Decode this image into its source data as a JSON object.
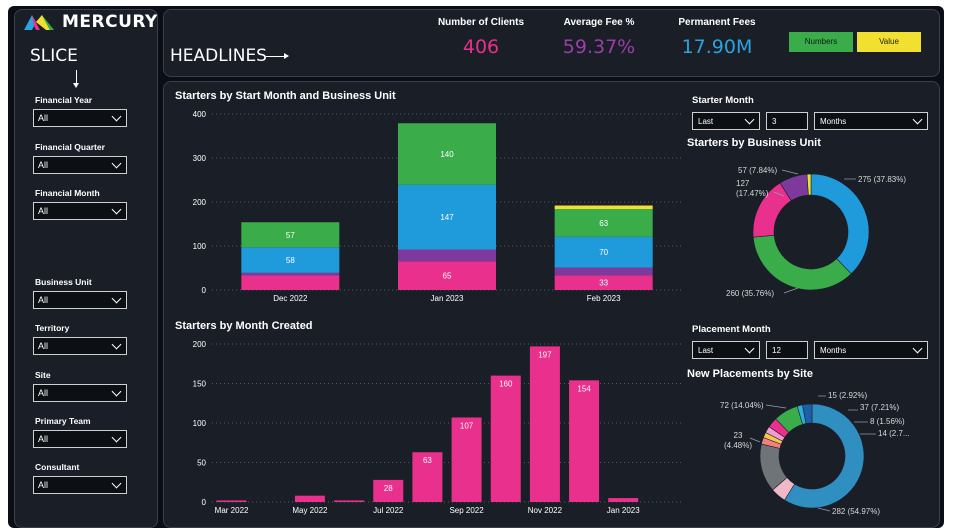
{
  "brand": {
    "name": "MERCURY"
  },
  "slicer": {
    "title": "SLICE",
    "filters": [
      {
        "label": "Financial Year",
        "value": "All"
      },
      {
        "label": "Financial Quarter",
        "value": "All"
      },
      {
        "label": "Financial Month",
        "value": "All"
      },
      {
        "label": "Business Unit",
        "value": "All"
      },
      {
        "label": "Territory",
        "value": "All"
      },
      {
        "label": "Site",
        "value": "All"
      },
      {
        "label": "Primary Team",
        "value": "All"
      },
      {
        "label": "Consultant",
        "value": "All"
      }
    ]
  },
  "header": {
    "title": "HEADLINES",
    "kpis": [
      {
        "label": "Number of Clients",
        "value": "406",
        "color": "#e8308c"
      },
      {
        "label": "Average Fee %",
        "value": "59.37%",
        "color": "#9b3ea8"
      },
      {
        "label": "Permanent Fees",
        "value": "17.90M",
        "color": "#2aa3e0"
      }
    ],
    "toggles": {
      "numbers": "Numbers",
      "value": "Value"
    }
  },
  "starter_month": {
    "title": "Starter Month",
    "period": "Last",
    "count": "3",
    "unit": "Months"
  },
  "placement_month": {
    "title": "Placement Month",
    "period": "Last",
    "count": "12",
    "unit": "Months"
  },
  "colors": {
    "pink": "#e8308c",
    "purple": "#7d3a9c",
    "blue": "#1f9bdc",
    "green": "#3aad4a",
    "yellow": "#f2e030"
  },
  "chart_data": [
    {
      "id": "starters_by_start_month",
      "type": "bar",
      "title": "Starters by Start Month and Business Unit",
      "categories": [
        "Dec 2022",
        "Jan 2023",
        "Feb 2023"
      ],
      "ylim": [
        0,
        400
      ],
      "yticks": [
        0,
        100,
        200,
        300,
        400
      ],
      "series": [
        {
          "values": [
            33,
            65,
            33
          ],
          "labels": [
            "",
            "65",
            "33"
          ],
          "color": "#e8308c"
        },
        {
          "values": [
            6,
            27,
            18
          ],
          "labels": [
            "",
            "",
            ""
          ],
          "color": "#7d3a9c"
        },
        {
          "values": [
            58,
            147,
            70
          ],
          "labels": [
            "58",
            "147",
            "70"
          ],
          "color": "#1f9bdc"
        },
        {
          "values": [
            57,
            140,
            63
          ],
          "labels": [
            "57",
            "140",
            "63"
          ],
          "color": "#3aad4a"
        },
        {
          "values": [
            0,
            0,
            8
          ],
          "labels": [
            "",
            "",
            ""
          ],
          "color": "#f2e030"
        }
      ]
    },
    {
      "id": "starters_by_business_unit",
      "type": "pie",
      "title": "Starters by Business Unit",
      "slices": [
        {
          "value": 275,
          "label": "275 (37.83%)",
          "color": "#1f9bdc"
        },
        {
          "value": 260,
          "label": "260 (35.76%)",
          "color": "#3aad4a"
        },
        {
          "value": 127,
          "label": "127 (17.47%)",
          "color": "#e8308c"
        },
        {
          "value": 57,
          "label": "57 (7.84%)",
          "color": "#7d3a9c"
        },
        {
          "value": 8,
          "label": "",
          "color": "#f2e030"
        }
      ]
    },
    {
      "id": "starters_by_month_created",
      "type": "bar",
      "title": "Starters by Month Created",
      "categories": [
        "Mar 2022",
        "Apr 2022",
        "May 2022",
        "Jun 2022",
        "Jul 2022",
        "Aug 2022",
        "Sep 2022",
        "Oct 2022",
        "Nov 2022",
        "Dec 2022",
        "Jan 2023",
        "Feb 2023"
      ],
      "tick_labels": [
        "Mar 2022",
        "",
        "May 2022",
        "",
        "Jul 2022",
        "",
        "Sep 2022",
        "",
        "Nov 2022",
        "",
        "Jan 2023",
        ""
      ],
      "values": [
        2,
        0,
        8,
        2,
        28,
        63,
        107,
        160,
        197,
        154,
        5,
        0
      ],
      "value_labels": [
        "",
        "",
        "",
        "",
        "28",
        "63",
        "107",
        "160",
        "197",
        "154",
        "",
        ""
      ],
      "bar_slots": [
        0,
        1,
        2,
        3,
        4,
        5,
        6,
        7,
        8,
        9,
        10,
        11
      ],
      "ylim": [
        0,
        200
      ],
      "yticks": [
        0,
        50,
        100,
        150,
        200
      ],
      "color": "#e8308c"
    },
    {
      "id": "new_placements_by_site",
      "type": "pie",
      "title": "New Placements by Site",
      "slices": [
        {
          "value": 282,
          "label": "282 (54.97%)",
          "color": "#2f8fc0"
        },
        {
          "value": 23,
          "label": "23 (4.48%)",
          "color": "#f0b9c7"
        },
        {
          "value": 72,
          "label": "72 (14.04%)",
          "color": "#6f7478"
        },
        {
          "value": 10,
          "label": "",
          "color": "#f37f7f"
        },
        {
          "value": 8,
          "label": "",
          "color": "#f2c84b"
        },
        {
          "value": 10,
          "label": "",
          "color": "#f39bd0"
        },
        {
          "value": 15,
          "label": "15 (2.92%)",
          "color": "#e8308c"
        },
        {
          "value": 37,
          "label": "37 (7.21%)",
          "color": "#3aad4a"
        },
        {
          "value": 8,
          "label": "8 (1.56%)",
          "color": "#2ab0e0"
        },
        {
          "value": 14,
          "label": "14 (2.7...",
          "color": "#1e5fa8"
        }
      ]
    }
  ]
}
